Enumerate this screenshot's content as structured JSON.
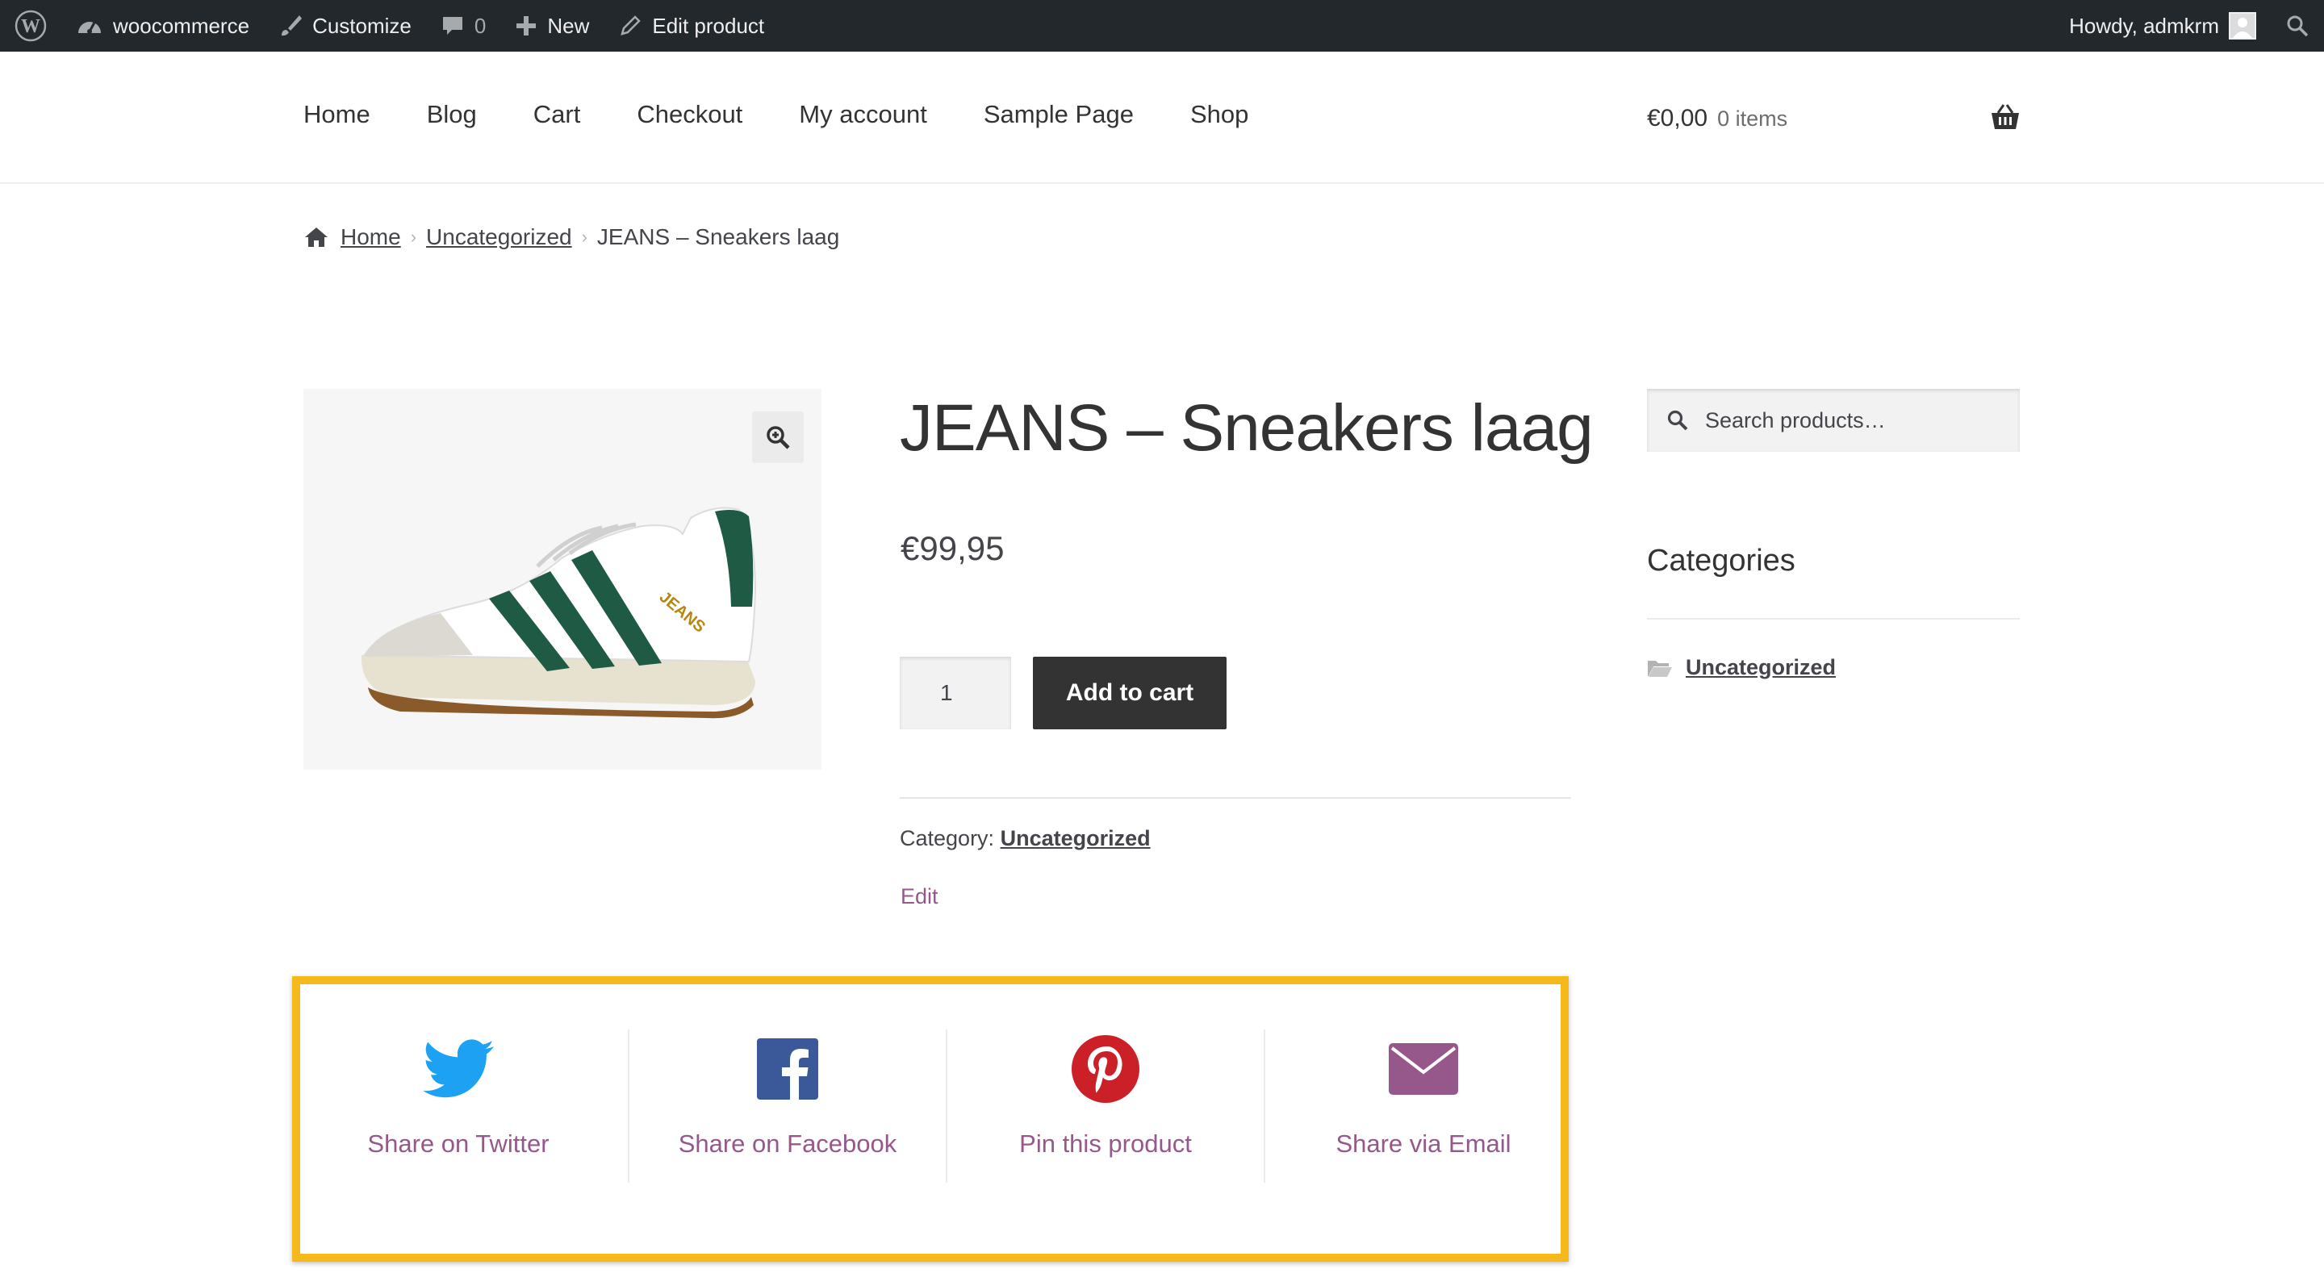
{
  "admin_bar": {
    "site_name": "woocommerce",
    "customize": "Customize",
    "comments_count": "0",
    "new": "New",
    "edit_product": "Edit product",
    "howdy": "Howdy, admkrm"
  },
  "nav": {
    "items": [
      "Home",
      "Blog",
      "Cart",
      "Checkout",
      "My account",
      "Sample Page",
      "Shop"
    ]
  },
  "cart": {
    "total": "€0,00",
    "count": "0 items"
  },
  "breadcrumb": {
    "home": "Home",
    "category": "Uncategorized",
    "current": "JEANS – Sneakers laag"
  },
  "product": {
    "title": "JEANS – Sneakers laag",
    "price": "€99,95",
    "quantity": "1",
    "add_to_cart": "Add to cart",
    "category_label": "Category:",
    "category": "Uncategorized",
    "edit": "Edit",
    "image_text": "JEANS"
  },
  "sidebar": {
    "search_placeholder": "Search products…",
    "categories_title": "Categories",
    "category_item": "Uncategorized"
  },
  "share": {
    "twitter": "Share on Twitter",
    "facebook": "Share on Facebook",
    "pinterest": "Pin this product",
    "email": "Share via Email",
    "colors": {
      "twitter": "#1da1f2",
      "facebook": "#3b5998",
      "pinterest": "#cb2027",
      "email": "#96588a",
      "highlight": "#f5b91c"
    }
  }
}
